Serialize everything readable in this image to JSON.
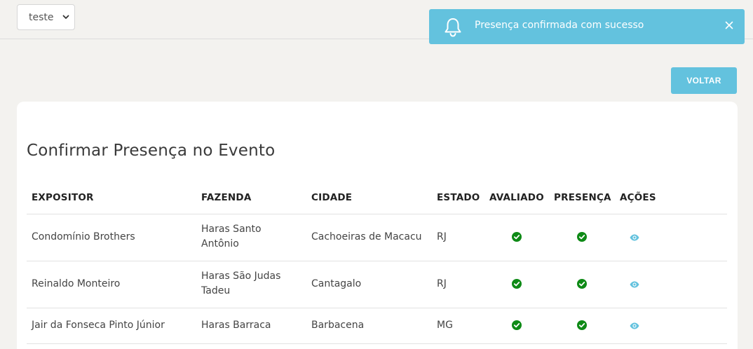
{
  "topbar": {
    "select_value": "teste"
  },
  "toast": {
    "message": "Presença confirmada com sucesso"
  },
  "actions": {
    "back_label": "VOLTAR"
  },
  "page": {
    "title": "Confirmar Presença no Evento"
  },
  "table": {
    "headers": {
      "expositor": "EXPOSITOR",
      "fazenda": "FAZENDA",
      "cidade": "CIDADE",
      "estado": "ESTADO",
      "avaliado": "AVALIADO",
      "presenca": "PRESENÇA",
      "acoes": "AÇÕES"
    },
    "rows": [
      {
        "expositor": "Condomínio Brothers",
        "fazenda_l1": "Haras Santo",
        "fazenda_l2": "Antônio",
        "cidade": "Cachoeiras de Macacu",
        "estado": "RJ",
        "avaliado": true,
        "presenca": true
      },
      {
        "expositor": "Reinaldo Monteiro",
        "fazenda_l1": "Haras São Judas",
        "fazenda_l2": "Tadeu",
        "cidade": "Cantagalo",
        "estado": "RJ",
        "avaliado": true,
        "presenca": true
      },
      {
        "expositor": "Jair da Fonseca Pinto Júnior",
        "fazenda_l1": "Haras Barraca",
        "fazenda_l2": "",
        "cidade": "Barbacena",
        "estado": "MG",
        "avaliado": true,
        "presenca": true
      }
    ]
  },
  "colors": {
    "accent": "#63c2de",
    "check": "#0e8a16",
    "background": "#f3f2ef"
  },
  "icons": {
    "toast": "bell-icon",
    "close": "close-icon",
    "avaliado": "check-circle-icon",
    "presenca": "check-circle-icon",
    "acao": "eye-icon",
    "select": "chevron-down-icon"
  }
}
